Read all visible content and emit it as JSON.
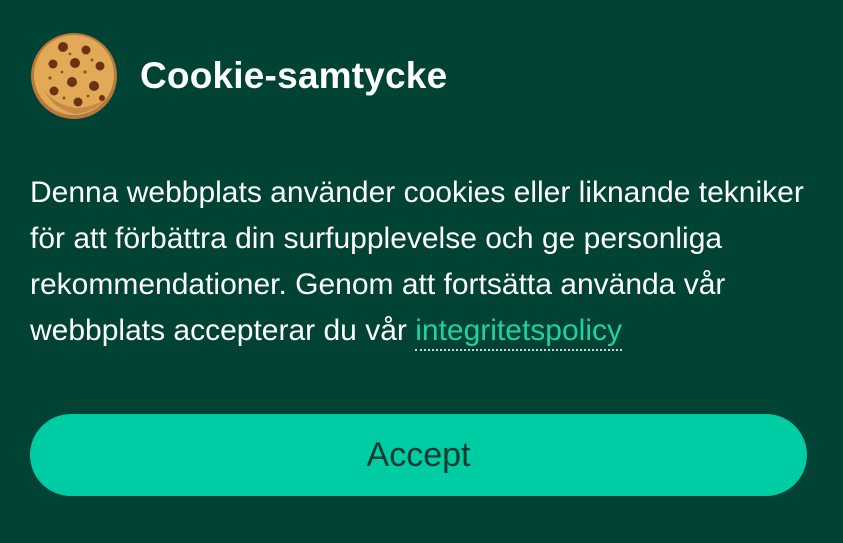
{
  "banner": {
    "title": "Cookie-samtycke",
    "icon": "cookie-icon",
    "text_before_link": "Denna webbplats använder cookies eller liknande tekniker för att förbättra din surfupplevelse och ge personliga rekommendationer. Genom att fortsätta använda vår webbplats accepterar du vår ",
    "policy_link_label": "integritetspolicy",
    "accept_label": "Accept"
  },
  "colors": {
    "background": "#004234",
    "accent": "#00cca3",
    "link": "#1fd1a5",
    "text": "#ffffff"
  }
}
